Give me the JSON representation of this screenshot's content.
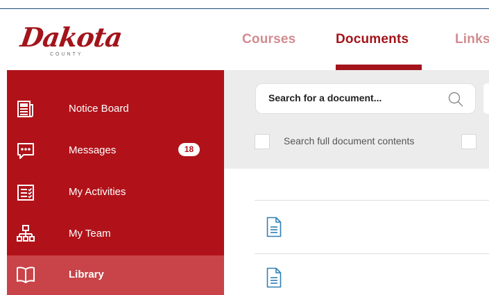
{
  "logo": {
    "script": "Dakota",
    "sub": "COUNTY"
  },
  "tabs": [
    {
      "label": "Courses",
      "active": false
    },
    {
      "label": "Documents",
      "active": true
    },
    {
      "label": "Links",
      "active": false
    }
  ],
  "sidebar": {
    "items": [
      {
        "label": "Notice Board",
        "icon": "notice-board-icon"
      },
      {
        "label": "Messages",
        "icon": "message-icon",
        "badge": "18"
      },
      {
        "label": "My Activities",
        "icon": "checklist-icon"
      },
      {
        "label": "My Team",
        "icon": "org-chart-icon"
      },
      {
        "label": "Library",
        "icon": "book-icon",
        "active": true
      }
    ]
  },
  "search": {
    "placeholder": "Search for a document...",
    "full_contents_label": "Search full document contents"
  },
  "colors": {
    "brand": "#a3141b",
    "sidebar": "#b11219",
    "sidebar_active": "#c84449",
    "tab_inactive": "#d28b8f",
    "doc_icon": "#2f7fb5"
  }
}
